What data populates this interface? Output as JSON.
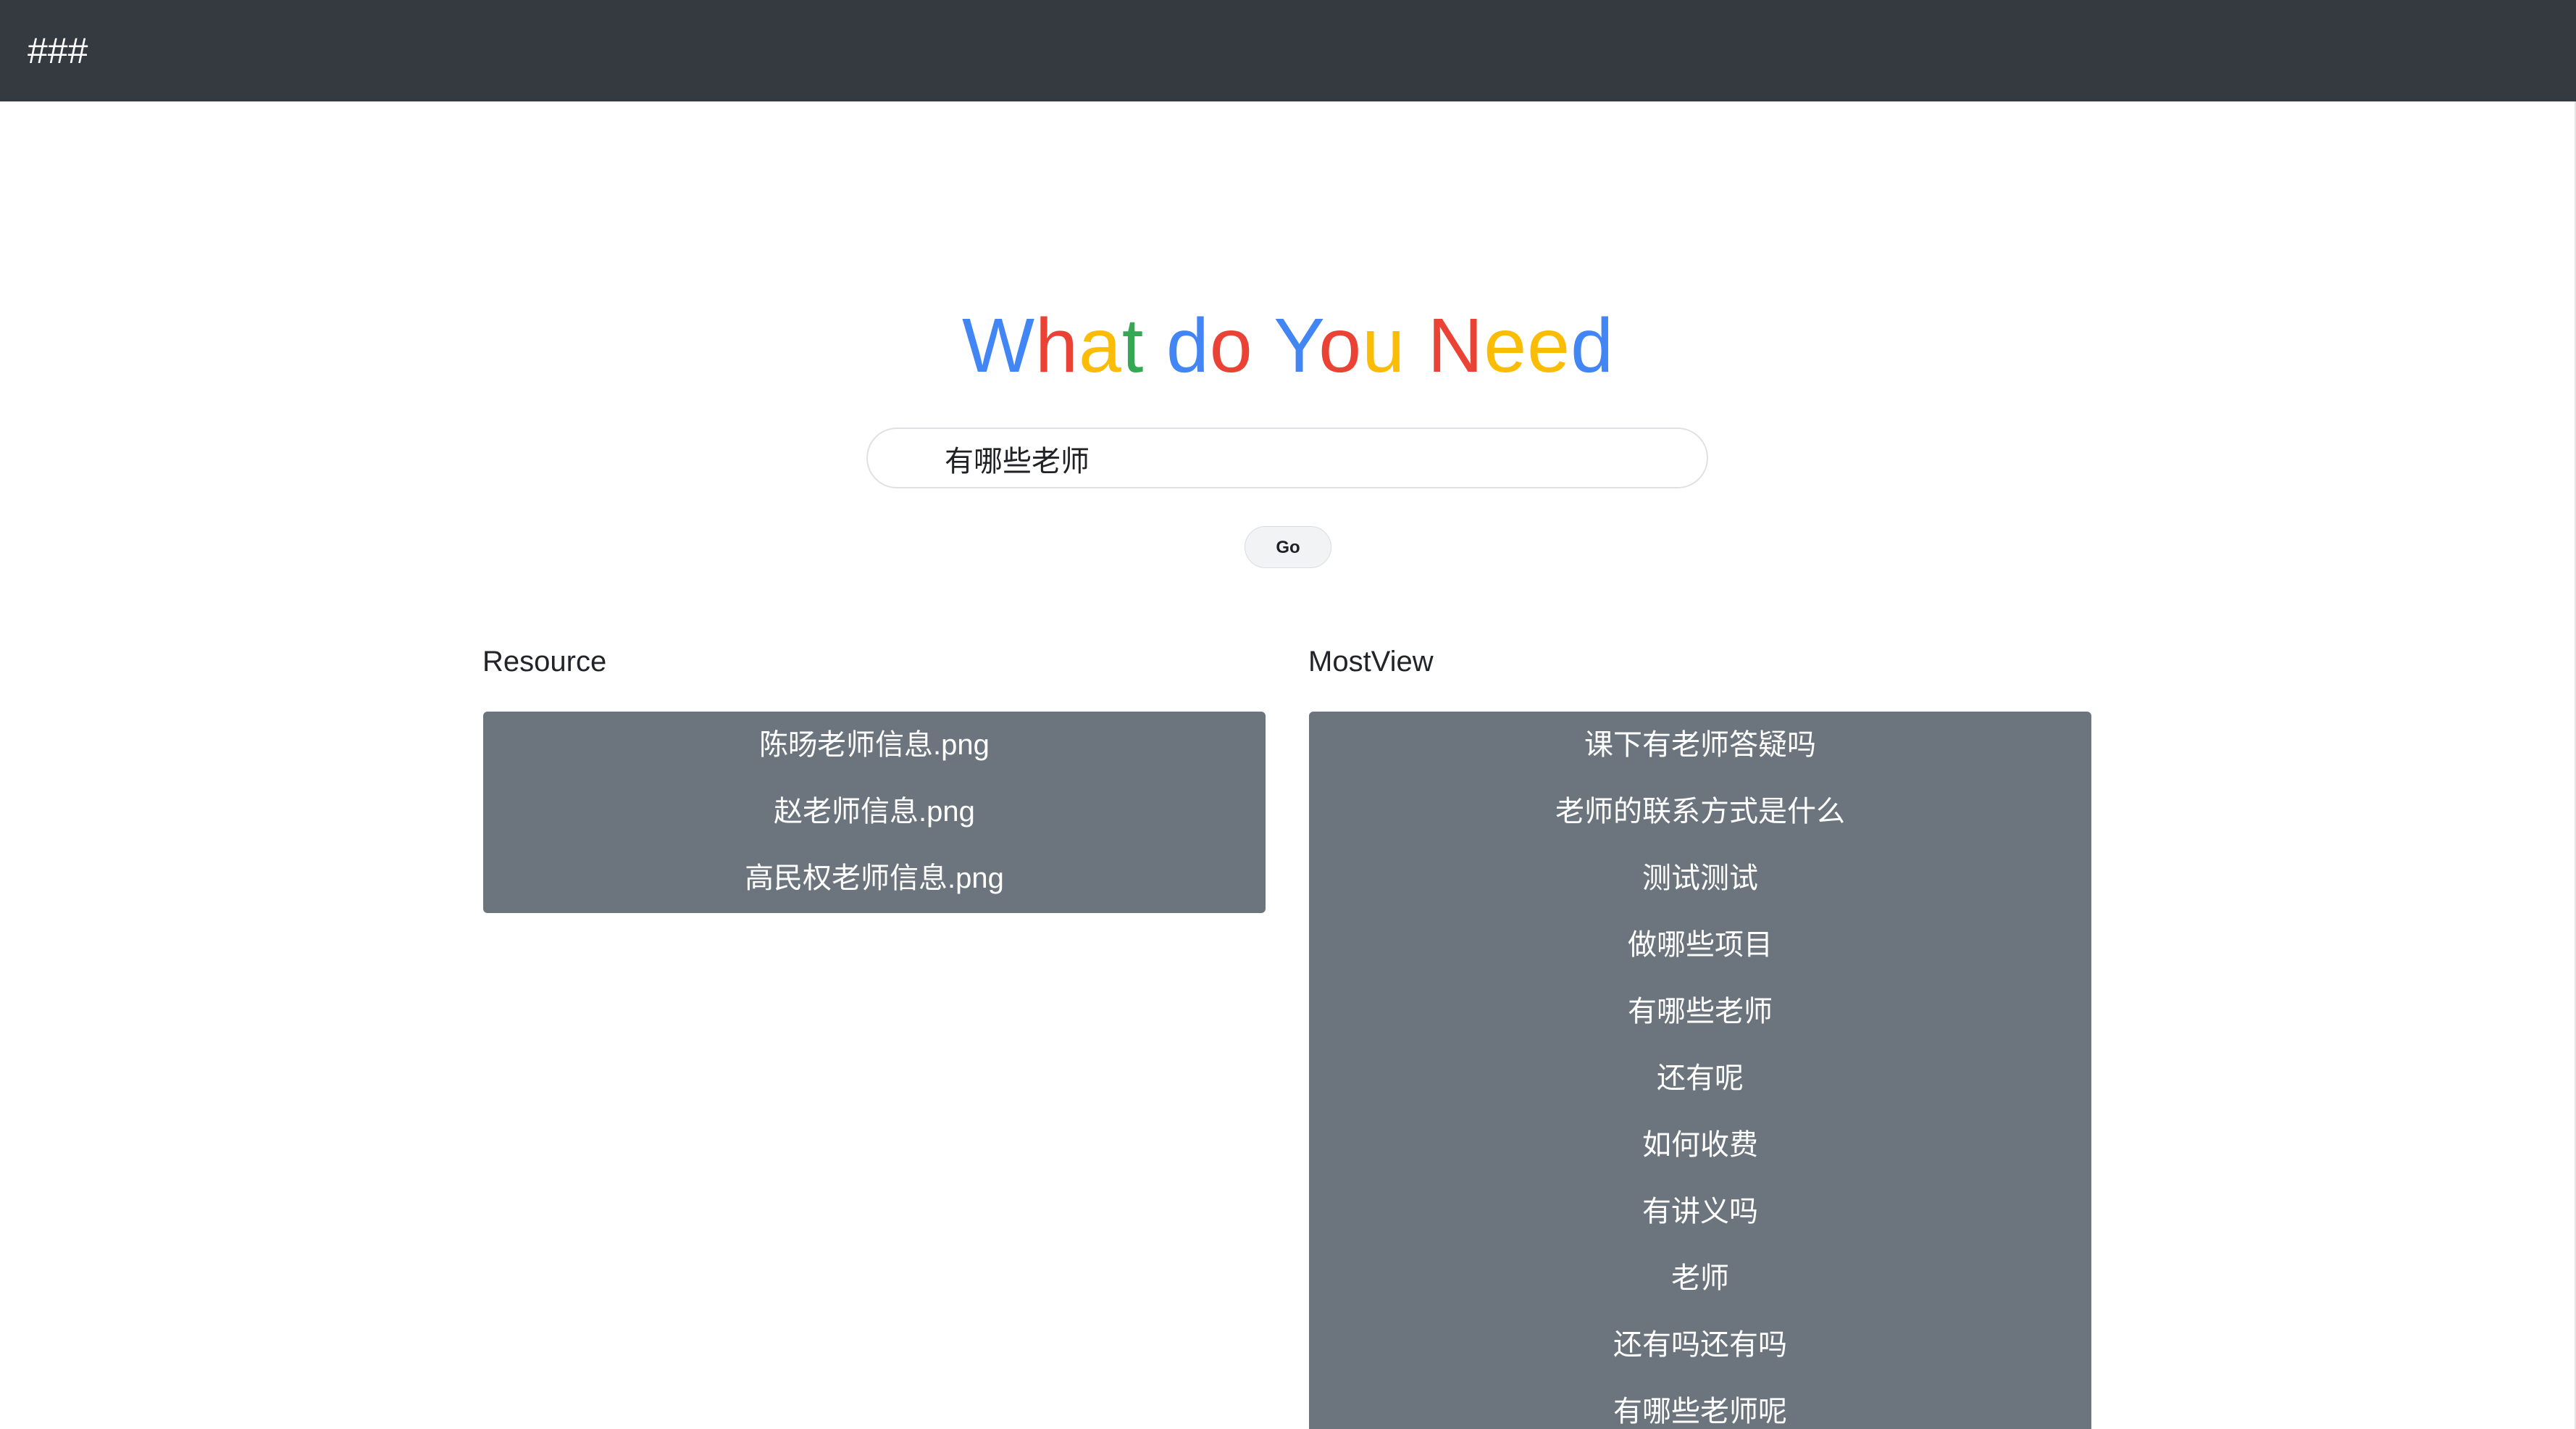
{
  "navbar": {
    "brand": "###"
  },
  "hero": {
    "title_words": [
      {
        "text": "W",
        "color": "#4285f4"
      },
      {
        "text": "h",
        "color": "#ea4335"
      },
      {
        "text": "a",
        "color": "#fbbc05"
      },
      {
        "text": "t",
        "color": "#34a853"
      },
      {
        "text": " ",
        "color": "#4285f4"
      },
      {
        "text": "d",
        "color": "#4285f4"
      },
      {
        "text": "o",
        "color": "#ea4335"
      },
      {
        "text": " ",
        "color": "#4285f4"
      },
      {
        "text": "Y",
        "color": "#4285f4"
      },
      {
        "text": "o",
        "color": "#ea4335"
      },
      {
        "text": "u",
        "color": "#fbbc05"
      },
      {
        "text": " ",
        "color": "#4285f4"
      },
      {
        "text": "N",
        "color": "#ea4335"
      },
      {
        "text": "e",
        "color": "#fbbc05"
      },
      {
        "text": "e",
        "color": "#fbbc05"
      },
      {
        "text": "d",
        "color": "#4285f4"
      }
    ]
  },
  "search": {
    "value": "有哪些老师",
    "button_label": "Go"
  },
  "resource": {
    "title": "Resource",
    "items": [
      "陈旸老师信息.png",
      "赵老师信息.png",
      "高民权老师信息.png"
    ]
  },
  "mostview": {
    "title": "MostView",
    "items": [
      "课下有老师答疑吗",
      "老师的联系方式是什么",
      "测试测试",
      "做哪些项目",
      "有哪些老师",
      "还有呢",
      "如何收费",
      "有讲义吗",
      "老师",
      "还有吗还有吗",
      "有哪些老师呢"
    ]
  },
  "colors": {
    "navbar_bg": "#343a40",
    "panel_bg": "#6c757d",
    "google_blue": "#4285f4",
    "google_red": "#ea4335",
    "google_yellow": "#fbbc05",
    "google_green": "#34a853"
  }
}
